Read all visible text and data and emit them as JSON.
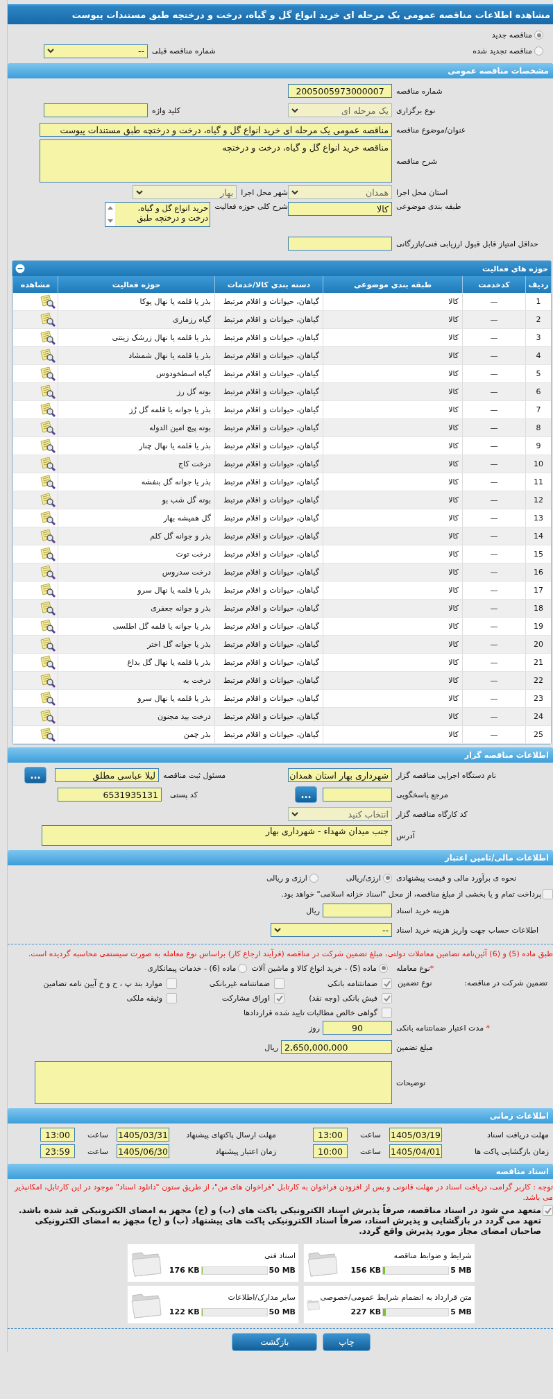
{
  "window": {
    "title": "مشاهده اطلاعات مناقصه عمومی یک مرحله ای خرید انواع گل و گیاه، درخت و درختچه طبق مستندات پیوست"
  },
  "tender_status": [
    {
      "label": "مناقصه جدید",
      "selected": true
    },
    {
      "label": "مناقصه تجدید شده",
      "selected": false
    }
  ],
  "previous_tender": {
    "label": "شماره مناقصه قبلی",
    "value": "--"
  },
  "general": {
    "header": "مشخصات مناقصه عمومی",
    "number": {
      "label": "شماره مناقصه",
      "value": "2005005973000007"
    },
    "method": {
      "label": "نوع برگزاری",
      "value": "یک مرحله ای"
    },
    "keyword": {
      "label": "کلید واژه"
    },
    "subject": {
      "label": "عنوان/موضوع مناقصه",
      "value": "مناقصه عمومی یک مرحله ای خرید انواع گل و گیاه، درخت و درختچه طبق مستندات پیوست"
    },
    "description": {
      "label": "شرح مناقصه",
      "value": "مناقصه خرید انواع گل و گیاه، درخت و درختچه"
    },
    "province": {
      "label": "استان محل اجرا",
      "value": "همدان"
    },
    "city": {
      "label": "شهر محل اجرا",
      "value": "بهار"
    },
    "classification": {
      "label": "طبقه بندی موضوعی",
      "value": "کالا"
    },
    "activity_summary": {
      "label": "شرح کلی حوزه فعالیت",
      "value": "خرید انواع گل و گیاه، درخت و درختچه طبق"
    },
    "min_score": {
      "label": "حداقل امتیاز قابل قبول ارزیابی فنی/بازرگانی"
    }
  },
  "activities": {
    "header": "حوزه های فعالیت",
    "columns": [
      "ردیف",
      "کدخدمت",
      "طبقه بندی موضوعی",
      "دسته بندی کالا/خدمات",
      "حوزه فعالیت",
      "مشاهده"
    ],
    "rows": [
      [
        "1",
        "—",
        "کالا",
        "گیاهان، حیوانات و اقلام مرتبط",
        "بذر یا قلمه یا نهال یوکا"
      ],
      [
        "2",
        "—",
        "کالا",
        "گیاهان، حیوانات و اقلام مرتبط",
        "گیاه رزماری"
      ],
      [
        "3",
        "—",
        "کالا",
        "گیاهان، حیوانات و اقلام مرتبط",
        "بذر یا قلمه یا نهال زرشک زینتی"
      ],
      [
        "4",
        "—",
        "کالا",
        "گیاهان، حیوانات و اقلام مرتبط",
        "بذر یا قلمه یا نهال شمشاد"
      ],
      [
        "5",
        "—",
        "کالا",
        "گیاهان، حیوانات و اقلام مرتبط",
        "گیاه اسطخودوس"
      ],
      [
        "6",
        "—",
        "کالا",
        "گیاهان، حیوانات و اقلام مرتبط",
        "بوته گل رز"
      ],
      [
        "7",
        "—",
        "کالا",
        "گیاهان، حیوانات و اقلام مرتبط",
        "بذر یا جوانه یا قلمه گل رُز"
      ],
      [
        "8",
        "—",
        "کالا",
        "گیاهان، حیوانات و اقلام مرتبط",
        "بوته پیچ امین الدوله"
      ],
      [
        "9",
        "—",
        "کالا",
        "گیاهان، حیوانات و اقلام مرتبط",
        "بذر یا قلمه یا نهال چنار"
      ],
      [
        "10",
        "—",
        "کالا",
        "گیاهان، حیوانات و اقلام مرتبط",
        "درخت کاج"
      ],
      [
        "11",
        "—",
        "کالا",
        "گیاهان، حیوانات و اقلام مرتبط",
        "بذر یا جوانه گل بنفشه"
      ],
      [
        "12",
        "—",
        "کالا",
        "گیاهان، حیوانات و اقلام مرتبط",
        "بوته گل شب بو"
      ],
      [
        "13",
        "—",
        "کالا",
        "گیاهان، حیوانات و اقلام مرتبط",
        "گل همیشه بهار"
      ],
      [
        "14",
        "—",
        "کالا",
        "گیاهان، حیوانات و اقلام مرتبط",
        "بذر و جوانه گل کلم"
      ],
      [
        "15",
        "—",
        "کالا",
        "گیاهان، حیوانات و اقلام مرتبط",
        "درخت توت"
      ],
      [
        "16",
        "—",
        "کالا",
        "گیاهان، حیوانات و اقلام مرتبط",
        "درخت سدروس"
      ],
      [
        "17",
        "—",
        "کالا",
        "گیاهان، حیوانات و اقلام مرتبط",
        "بذر یا قلمه یا نهال سرو"
      ],
      [
        "18",
        "—",
        "کالا",
        "گیاهان، حیوانات و اقلام مرتبط",
        "بذر و جوانه جعفری"
      ],
      [
        "19",
        "—",
        "کالا",
        "گیاهان، حیوانات و اقلام مرتبط",
        "بذر یا جوانه یا قلمه گل اطلسی"
      ],
      [
        "20",
        "—",
        "کالا",
        "گیاهان، حیوانات و اقلام مرتبط",
        "بذر یا جوانه گل اختر"
      ],
      [
        "21",
        "—",
        "کالا",
        "گیاهان، حیوانات و اقلام مرتبط",
        "بذر یا قلمه یا نهال گل بداغ"
      ],
      [
        "22",
        "—",
        "کالا",
        "گیاهان، حیوانات و اقلام مرتبط",
        "درخت به"
      ],
      [
        "23",
        "—",
        "کالا",
        "گیاهان، حیوانات و اقلام مرتبط",
        "بذر یا قلمه یا نهال سرو"
      ],
      [
        "24",
        "—",
        "کالا",
        "گیاهان، حیوانات و اقلام مرتبط",
        "درخت بید مجنون"
      ],
      [
        "25",
        "—",
        "کالا",
        "گیاهان، حیوانات و اقلام مرتبط",
        "بذر چمن"
      ]
    ]
  },
  "organizer": {
    "header": "اطلاعات مناقصه گزار",
    "agency": {
      "label": "نام دستگاه اجرایی مناقصه گزار",
      "value": "شهرداری بهار استان همدان"
    },
    "registrar": {
      "label": "مسئول ثبت مناقصه",
      "value": "لیلا عباسی مطلق",
      "button": "..."
    },
    "reference": {
      "label": "مرجع پاسخگویی",
      "button": "..."
    },
    "postal_code": {
      "label": "کد پستی",
      "value": "6531935131"
    },
    "workshop": {
      "label": "کد کارگاه مناقصه گزار",
      "value": "انتخاب کنید"
    },
    "address": {
      "label": "آدرس",
      "value": "جنب میدان شهداء - شهرداری بهار"
    }
  },
  "finance": {
    "header": "اطلاعات مالی/تامین اعتبار",
    "estimate": {
      "label": "نحوه ی برآورد مالی و قیمت پیشنهادی",
      "options": [
        {
          "label": "ارزی/ریالی",
          "selected": true
        },
        {
          "label": "ارزی و ریالی",
          "selected": false
        }
      ]
    },
    "treasury": {
      "label": "پرداخت تمام و یا بخشی از مبلغ مناقصه، از محل \"اسناد خزانه اسلامی\" خواهد بود.",
      "checked": false
    },
    "document_fee": {
      "label": "هزینه خرید اسناد",
      "unit": "ریال"
    },
    "account": {
      "label": "اطلاعات حساب جهت واریز هزینه خرید اسناد",
      "value": "--"
    },
    "notice": "طبق ماده (5) و (6) آئین‌نامه تضامین معاملات دولتی، مبلغ تضمین شرکت در مناقصه (فرآیند ارجاع کار) براساس نوع معامله به صورت سیستمی محاسبه گردیده است.",
    "deal_type": {
      "label": "نوع معامله",
      "required": "*",
      "options": [
        {
          "label": "ماده (5) - خرید انواع کالا و ماشین آلات",
          "selected": true
        },
        {
          "label": "ماده (6) - خدمات پیمانکاری",
          "selected": false
        }
      ]
    },
    "guarantee": {
      "label": "تضمین شرکت در مناقصه:",
      "type_label": "نوع تضمین",
      "options": [
        {
          "label": "ضمانتنامه بانکی",
          "checked": true
        },
        {
          "label": "ضمانتنامه غیربانکی",
          "checked": false
        },
        {
          "label": "موارد بند پ ، ح و خ آیین نامه تضامین",
          "checked": false
        },
        {
          "label": "فیش بانکی (وجه نقد)",
          "checked": true
        },
        {
          "label": "اوراق مشارکت",
          "checked": true
        },
        {
          "label": "وثیقه ملکی",
          "checked": false
        },
        {
          "label": "گواهی خالص مطالبات تایید شده قراردادها",
          "checked": false
        }
      ]
    },
    "validity": {
      "label": "مدت اعتبار ضمانتنامه بانکی",
      "required": "*",
      "value": "90",
      "unit": "روز"
    },
    "amount": {
      "label": "مبلغ تضمین",
      "value": "2,650,000,000",
      "unit": "ریال"
    },
    "remarks": {
      "label": "توضیحات"
    }
  },
  "timing": {
    "header": "اطلاعات زمانی",
    "items": [
      {
        "label": "مهلت دریافت اسناد",
        "date": "1405/03/19",
        "time_label": "ساعت",
        "time": "13:00"
      },
      {
        "label": "مهلت ارسال پاکتهای پیشنهاد",
        "date": "1405/03/31",
        "time_label": "ساعت",
        "time": "13:00"
      },
      {
        "label": "زمان بازگشایی پاکت ها",
        "date": "1405/04/01",
        "time_label": "ساعت",
        "time": "10:00"
      },
      {
        "label": "زمان اعتبار پیشنهاد",
        "date": "1405/06/30",
        "time_label": "ساعت",
        "time": "23:59"
      }
    ]
  },
  "documents": {
    "header": "اسناد مناقصه",
    "notice": "توجه : کاربر گرامی، دریافت اسناد در مهلت قانونی و پس از افزودن فراخوان به کارتابل \"فراخوان های من\"، از طریق ستون \"دانلود اسناد\" موجود در این کارتابل، امکانپذیر می باشد.",
    "commitment": {
      "label": "متعهد می شود در اسناد مناقصه، صرفاً پذیرش اسناد الکترونیکی پاکت های (ب) و (ج) مجهز به امضای الکترونیکی قید شده باشد. تعهد می گردد در بازگشایی و پذیرش اسناد، صرفاً اسناد الکترونیکی پاکت های پیشنهاد (ب) و (ج) مجهز به امضای الکترونیکی صاحبان امضای مجاز مورد پذیرش واقع گردد.",
      "checked": true
    },
    "files": [
      {
        "name": "شرایط و ضوابط مناقصه",
        "size": "156 KB",
        "max": "5 MB",
        "level": 0.03
      },
      {
        "name": "اسناد فنی",
        "size": "176 KB",
        "max": "50 MB",
        "level": 0.004
      },
      {
        "name": "متن قرارداد به انضمام شرایط عمومی/خصوصی",
        "size": "227 KB",
        "max": "5 MB",
        "level": 0.044
      },
      {
        "name": "سایر مدارک/اطلاعات",
        "size": "122 KB",
        "max": "50 MB",
        "level": 0.002
      }
    ]
  },
  "buttons": [
    "چاپ",
    "بازگشت"
  ]
}
